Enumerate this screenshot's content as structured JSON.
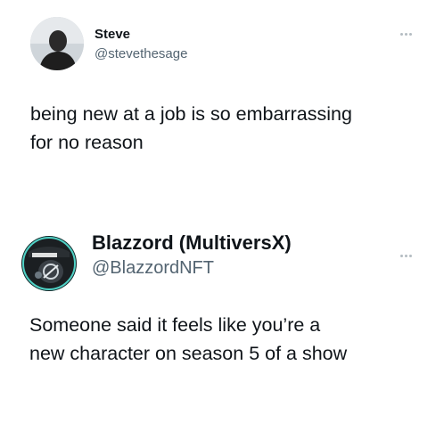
{
  "tweets": [
    {
      "display_name": "Steve",
      "handle": "@stevethesage",
      "text_line_1": "being new at a job is so embarrassing",
      "text_line_2": "for no reason",
      "avatar_icon": "person-photo-icon",
      "more_icon": "more-options-icon"
    },
    {
      "display_name": "Blazzord (MultiversX)",
      "handle": "@BlazzordNFT",
      "text_line_1": "Someone said it feels like you’re a",
      "text_line_2": "new character on season 5 of a show",
      "avatar_icon": "nft-character-icon",
      "more_icon": "more-options-icon"
    }
  ],
  "colors": {
    "text": "#0f1419",
    "secondary": "#536471",
    "accent_ring": "#4fd1c5"
  }
}
